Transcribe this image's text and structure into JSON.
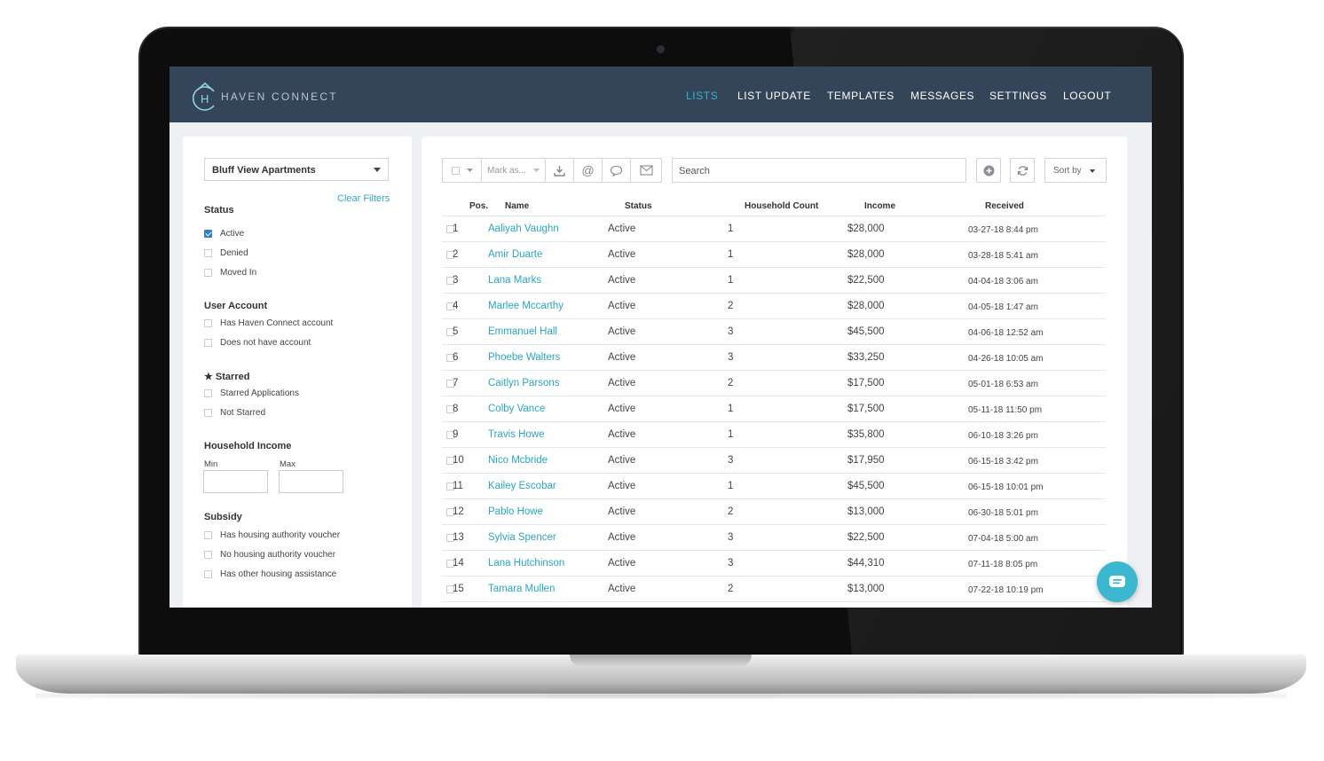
{
  "app": {
    "brand_name": "HAVEN CONNECT",
    "logo_letter": "H",
    "nav": [
      {
        "label": "LISTS",
        "active": true
      },
      {
        "label": "LIST UPDATE",
        "active": false
      },
      {
        "label": "TEMPLATES",
        "active": false
      },
      {
        "label": "MESSAGES",
        "active": false
      },
      {
        "label": "SETTINGS",
        "active": false
      },
      {
        "label": "LOGOUT",
        "active": false
      }
    ],
    "colors": {
      "navbar": "#344559",
      "accent": "#35b3cc",
      "link": "#2aa6c2",
      "checkbox_checked": "#2f80c4"
    }
  },
  "sidebar": {
    "property_select": "Bluff View Apartments",
    "clear_filters": "Clear Filters",
    "status": {
      "title": "Status",
      "options": [
        {
          "label": "Active",
          "checked": true
        },
        {
          "label": "Denied",
          "checked": false
        },
        {
          "label": "Moved In",
          "checked": false
        }
      ]
    },
    "user_account": {
      "title": "User Account",
      "options": [
        {
          "label": "Has Haven Connect account",
          "checked": false
        },
        {
          "label": "Does not have account",
          "checked": false
        }
      ]
    },
    "starred": {
      "title": "★ Starred",
      "options": [
        {
          "label": "Starred Applications",
          "checked": false
        },
        {
          "label": "Not Starred",
          "checked": false
        }
      ]
    },
    "household_income": {
      "title": "Household Income",
      "min_label": "Min",
      "max_label": "Max",
      "min_value": "",
      "max_value": ""
    },
    "subsidy": {
      "title": "Subsidy",
      "options": [
        {
          "label": "Has housing authority voucher",
          "checked": false
        },
        {
          "label": "No housing authority voucher",
          "checked": false
        },
        {
          "label": "Has other housing assistance",
          "checked": false
        }
      ]
    }
  },
  "toolbar": {
    "mark_as": "Mark as...",
    "search_placeholder": "Search",
    "sort_by": "Sort by",
    "icons": [
      "checkbox-icon",
      "download-icon",
      "at-icon",
      "comment-icon",
      "envelope-icon",
      "add-icon",
      "refresh-icon"
    ]
  },
  "table": {
    "headers": [
      "Pos.",
      "Name",
      "Status",
      "Household Count",
      "Income",
      "Received"
    ],
    "rows": [
      {
        "pos": "1",
        "name": "Aaliyah Vaughn",
        "status": "Active",
        "count": "1",
        "income": "$28,000",
        "received": "03-27-18 8:44 pm"
      },
      {
        "pos": "2",
        "name": "Amir Duarte",
        "status": "Active",
        "count": "1",
        "income": "$28,000",
        "received": "03-28-18 5:41 am"
      },
      {
        "pos": "3",
        "name": "Lana Marks",
        "status": "Active",
        "count": "1",
        "income": "$22,500",
        "received": "04-04-18 3:06 am"
      },
      {
        "pos": "4",
        "name": "Marlee Mccarthy",
        "status": "Active",
        "count": "2",
        "income": "$28,000",
        "received": "04-05-18 1:47 am"
      },
      {
        "pos": "5",
        "name": "Emmanuel Hall",
        "status": "Active",
        "count": "3",
        "income": "$45,500",
        "received": "04-06-18 12:52 am"
      },
      {
        "pos": "6",
        "name": "Phoebe Walters",
        "status": "Active",
        "count": "3",
        "income": "$33,250",
        "received": "04-26-18 10:05 am"
      },
      {
        "pos": "7",
        "name": "Caitlyn Parsons",
        "status": "Active",
        "count": "2",
        "income": "$17,500",
        "received": "05-01-18 6:53 am"
      },
      {
        "pos": "8",
        "name": "Colby Vance",
        "status": "Active",
        "count": "1",
        "income": "$17,500",
        "received": "05-11-18 11:50 pm"
      },
      {
        "pos": "9",
        "name": "Travis Howe",
        "status": "Active",
        "count": "1",
        "income": "$35,800",
        "received": "06-10-18 3:26 pm"
      },
      {
        "pos": "10",
        "name": "Nico Mcbride",
        "status": "Active",
        "count": "3",
        "income": "$17,950",
        "received": "06-15-18 3:42 pm"
      },
      {
        "pos": "11",
        "name": "Kailey Escobar",
        "status": "Active",
        "count": "1",
        "income": "$45,500",
        "received": "06-15-18 10:01 pm"
      },
      {
        "pos": "12",
        "name": "Pablo Howe",
        "status": "Active",
        "count": "2",
        "income": "$13,000",
        "received": "06-30-18 5:01 pm"
      },
      {
        "pos": "13",
        "name": "Sylvia Spencer",
        "status": "Active",
        "count": "3",
        "income": "$22,500",
        "received": "07-04-18 5:00 am"
      },
      {
        "pos": "14",
        "name": "Lana Hutchinson",
        "status": "Active",
        "count": "3",
        "income": "$44,310",
        "received": "07-11-18 8:05 pm"
      },
      {
        "pos": "15",
        "name": "Tamara Mullen",
        "status": "Active",
        "count": "2",
        "income": "$13,000",
        "received": "07-22-18 10:19 pm"
      }
    ]
  },
  "chat_button": {
    "icon": "chat-icon"
  }
}
